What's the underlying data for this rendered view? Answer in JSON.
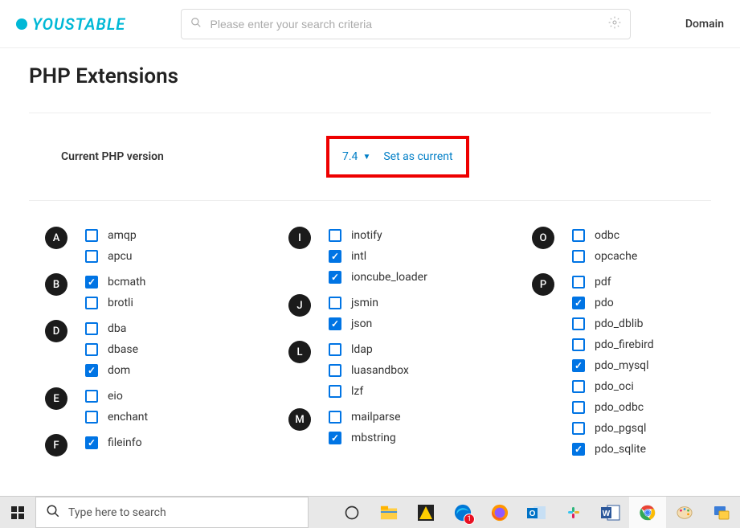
{
  "header": {
    "logo_text": "YOUSTABLE",
    "search_placeholder": "Please enter your search criteria",
    "nav_right_label": "Domain"
  },
  "page": {
    "title": "PHP Extensions",
    "version_label": "Current PHP version",
    "version_value": "7.4",
    "set_current_label": "Set as current"
  },
  "columns": [
    [
      {
        "letter": "A",
        "items": [
          {
            "name": "amqp",
            "checked": false
          },
          {
            "name": "apcu",
            "checked": false
          }
        ]
      },
      {
        "letter": "B",
        "items": [
          {
            "name": "bcmath",
            "checked": true
          },
          {
            "name": "brotli",
            "checked": false
          }
        ]
      },
      {
        "letter": "D",
        "items": [
          {
            "name": "dba",
            "checked": false
          },
          {
            "name": "dbase",
            "checked": false
          },
          {
            "name": "dom",
            "checked": true
          }
        ]
      },
      {
        "letter": "E",
        "items": [
          {
            "name": "eio",
            "checked": false
          },
          {
            "name": "enchant",
            "checked": false
          }
        ]
      },
      {
        "letter": "F",
        "items": [
          {
            "name": "fileinfo",
            "checked": true
          }
        ]
      }
    ],
    [
      {
        "letter": "I",
        "items": [
          {
            "name": "inotify",
            "checked": false
          },
          {
            "name": "intl",
            "checked": true
          },
          {
            "name": "ioncube_loader",
            "checked": true
          }
        ]
      },
      {
        "letter": "J",
        "items": [
          {
            "name": "jsmin",
            "checked": false
          },
          {
            "name": "json",
            "checked": true
          }
        ]
      },
      {
        "letter": "L",
        "items": [
          {
            "name": "ldap",
            "checked": false
          },
          {
            "name": "luasandbox",
            "checked": false
          },
          {
            "name": "lzf",
            "checked": false
          }
        ]
      },
      {
        "letter": "M",
        "items": [
          {
            "name": "mailparse",
            "checked": false
          },
          {
            "name": "mbstring",
            "checked": true
          }
        ]
      }
    ],
    [
      {
        "letter": "O",
        "items": [
          {
            "name": "odbc",
            "checked": false
          },
          {
            "name": "opcache",
            "checked": false
          }
        ]
      },
      {
        "letter": "P",
        "items": [
          {
            "name": "pdf",
            "checked": false
          },
          {
            "name": "pdo",
            "checked": true
          },
          {
            "name": "pdo_dblib",
            "checked": false
          },
          {
            "name": "pdo_firebird",
            "checked": false
          },
          {
            "name": "pdo_mysql",
            "checked": true
          },
          {
            "name": "pdo_oci",
            "checked": false
          },
          {
            "name": "pdo_odbc",
            "checked": false
          },
          {
            "name": "pdo_pgsql",
            "checked": false
          },
          {
            "name": "pdo_sqlite",
            "checked": true
          }
        ]
      }
    ]
  ],
  "taskbar": {
    "search_text": "Type here to search",
    "edge_badge": "1"
  }
}
